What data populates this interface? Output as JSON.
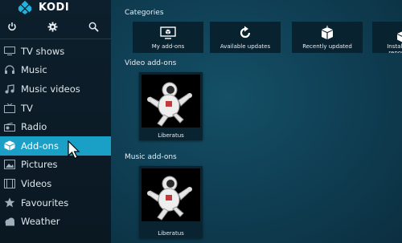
{
  "app": {
    "name": "KODI"
  },
  "top_icons": [
    "power-icon",
    "gear-icon",
    "search-icon"
  ],
  "menu": [
    {
      "label": "TV shows",
      "icon": "tv-icon",
      "active": false
    },
    {
      "label": "Music",
      "icon": "headphones-icon",
      "active": false
    },
    {
      "label": "Music videos",
      "icon": "music-video-icon",
      "active": false
    },
    {
      "label": "TV",
      "icon": "tv-screen-icon",
      "active": false
    },
    {
      "label": "Radio",
      "icon": "radio-icon",
      "active": false
    },
    {
      "label": "Add-ons",
      "icon": "box-icon",
      "active": true
    },
    {
      "label": "Pictures",
      "icon": "picture-icon",
      "active": false
    },
    {
      "label": "Videos",
      "icon": "film-icon",
      "active": false
    },
    {
      "label": "Favourites",
      "icon": "star-icon",
      "active": false
    },
    {
      "label": "Weather",
      "icon": "cloud-icon",
      "active": false
    }
  ],
  "categories": {
    "title": "Categories",
    "items": [
      {
        "label": "My add-ons",
        "icon": "monitor-box-icon"
      },
      {
        "label": "Available updates",
        "icon": "refresh-icon"
      },
      {
        "label": "Recently updated",
        "icon": "open-box-icon"
      },
      {
        "label": "Install from repository",
        "icon": "download-box-icon"
      }
    ]
  },
  "video_addons": {
    "title": "Video add-ons",
    "items": [
      {
        "label": "Liberatus"
      }
    ]
  },
  "music_addons": {
    "title": "Music add-ons",
    "items": [
      {
        "label": "Liberatus"
      }
    ]
  },
  "colors": {
    "accent": "#1aa0c7",
    "background": "#0f3a4d",
    "sidebar": "#0d1f2c"
  }
}
